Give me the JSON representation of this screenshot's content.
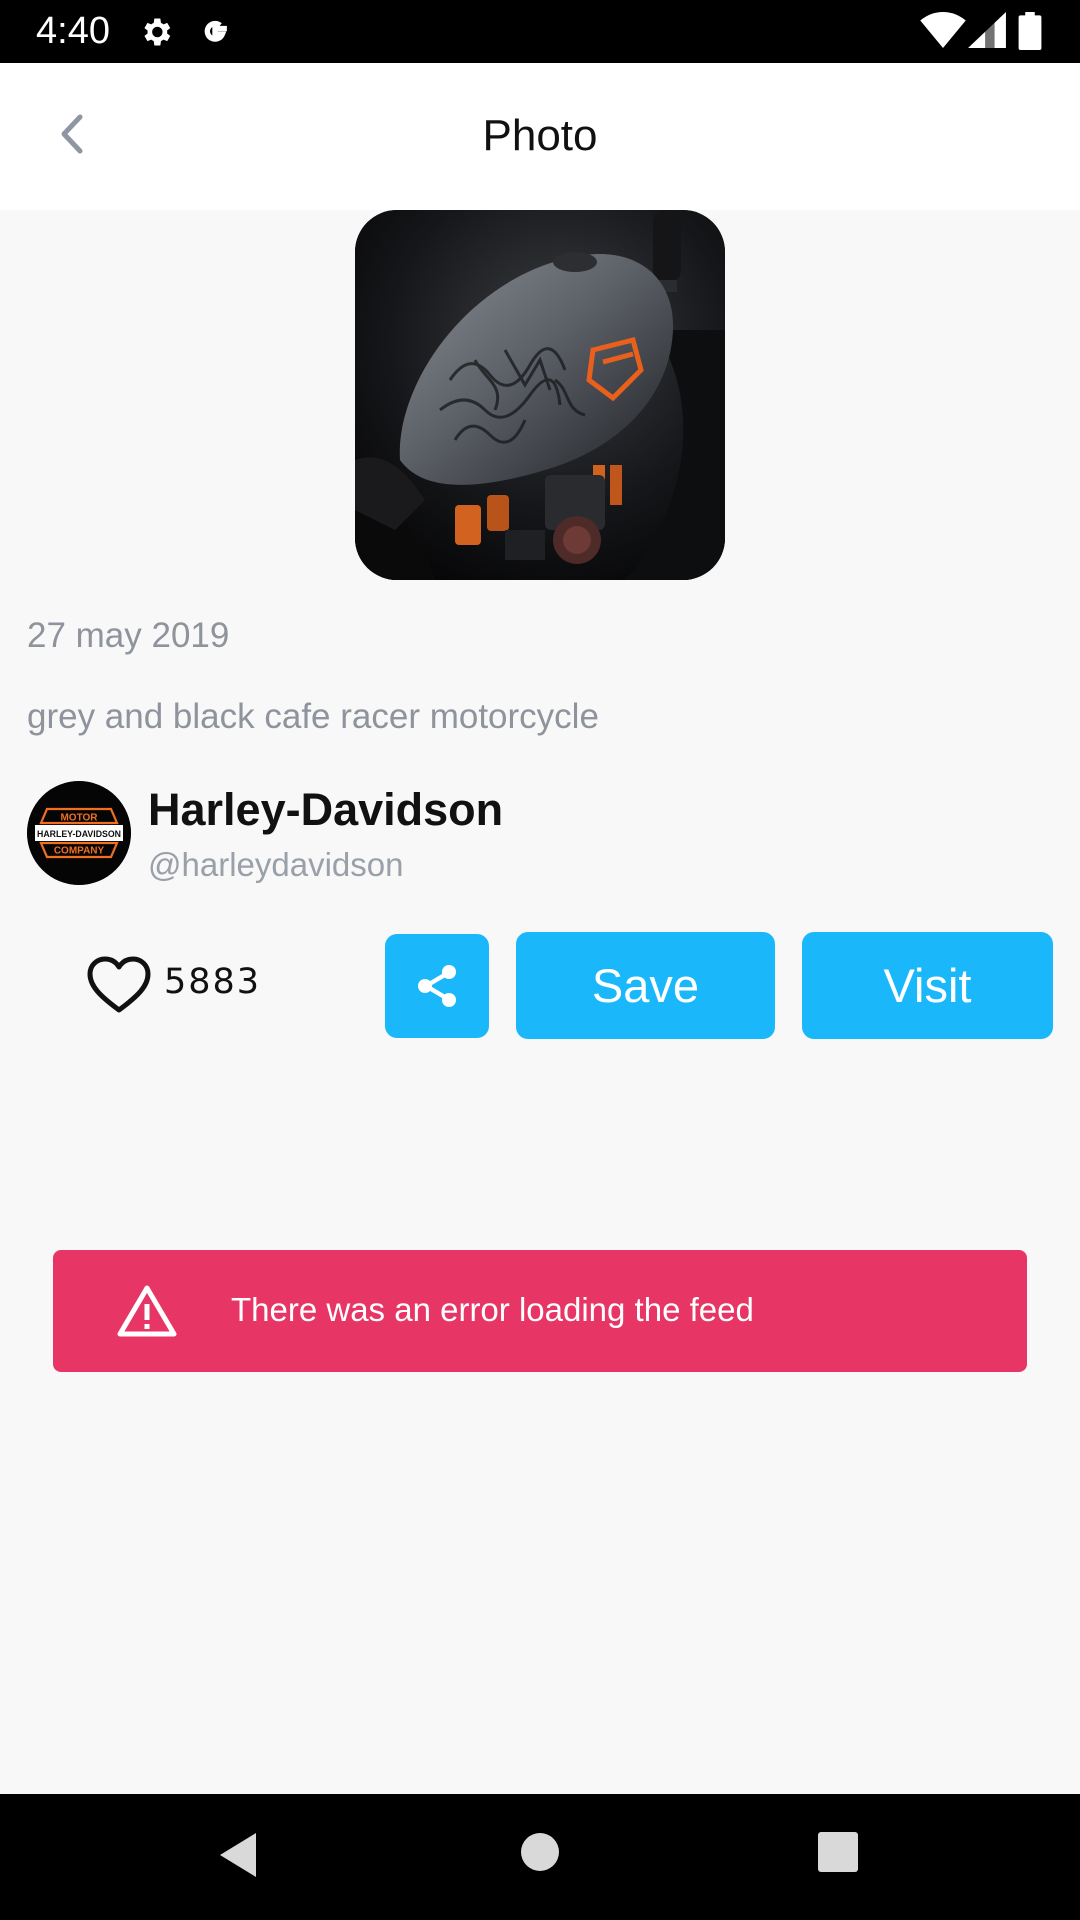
{
  "status_bar": {
    "time": "4:40",
    "icons": [
      "gear-icon",
      "google-icon",
      "wifi-icon",
      "cell-signal-icon",
      "battery-icon"
    ]
  },
  "app_bar": {
    "title": "Photo",
    "back_icon": "chevron-left-icon"
  },
  "photo": {
    "date": "27 may 2019",
    "description": "grey and black cafe racer motorcycle"
  },
  "author": {
    "name": "Harley-Davidson",
    "handle": "@harleydavidson",
    "logo_text": {
      "top": "MOTOR",
      "middle": "HARLEY-DAVIDSON",
      "bottom": "COMPANY"
    }
  },
  "actions": {
    "likes": "5883",
    "share_icon": "share-icon",
    "save_label": "Save",
    "visit_label": "Visit"
  },
  "error": {
    "message": "There was an error loading the feed",
    "icon": "warning-icon"
  },
  "nav_bar": {
    "icons": [
      "nav-back-icon",
      "nav-home-icon",
      "nav-recents-icon"
    ]
  },
  "colors": {
    "accent": "#1ab8fa",
    "error": "#e73665",
    "muted_text": "#8e939c",
    "logo_orange": "#f26f21"
  }
}
